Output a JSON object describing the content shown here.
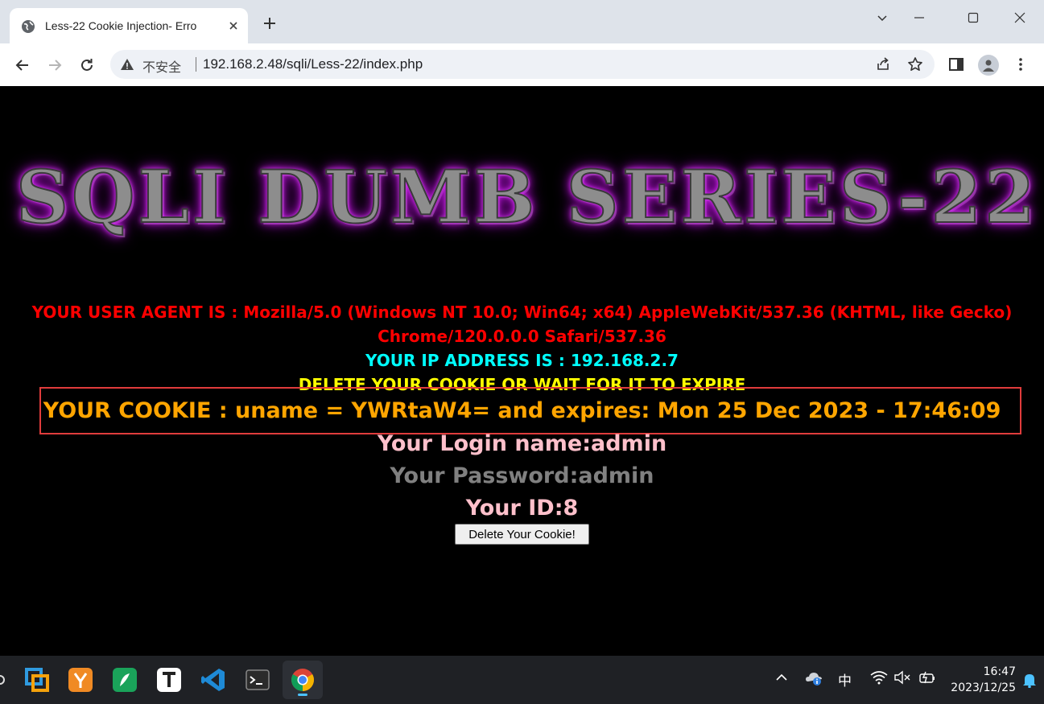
{
  "browser": {
    "tab_title": "Less-22 Cookie Injection- Erro",
    "security_label": "不安全",
    "url": "192.168.2.48/sqli/Less-22/index.php"
  },
  "page": {
    "banner_text": "SQLI DUMB SERIES-22",
    "user_agent_line1": "YOUR USER AGENT IS : Mozilla/5.0 (Windows NT 10.0; Win64; x64) AppleWebKit/537.36 (KHTML, like Gecko)",
    "user_agent_line2": "Chrome/120.0.0.0 Safari/537.36",
    "ip_line": "YOUR IP ADDRESS IS : 192.168.2.7",
    "delete_notice": "DELETE YOUR COOKIE OR WAIT FOR IT TO EXPIRE",
    "cookie_line": "YOUR COOKIE : uname = YWRtaW4= and expires: Mon 25 Dec 2023 - 17:46:09",
    "login_name": "Your Login name:admin",
    "password": "Your Password:admin",
    "user_id": "Your ID:8",
    "delete_button": "Delete Your Cookie!"
  },
  "taskbar": {
    "ime_label": "中",
    "time": "16:47",
    "date": "2023/12/25"
  },
  "colors": {
    "user_agent": "#ff0000",
    "ip": "#00ffff",
    "delete_notice": "#ffff00",
    "cookie": "#ffa500",
    "login": "#ffc0cb",
    "password": "#808080",
    "highlight_border": "#e03c3c"
  }
}
